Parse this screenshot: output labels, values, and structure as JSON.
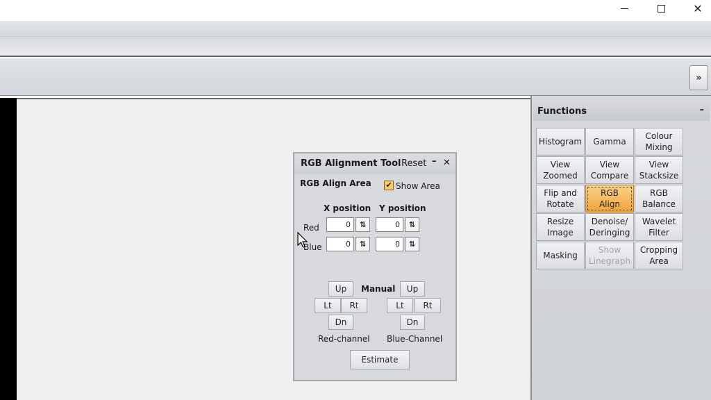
{
  "window": {
    "minimize_glyph": "—",
    "maximize_glyph": "☐",
    "close_glyph": "✕"
  },
  "toolbar": {
    "expand_label": "»"
  },
  "functions": {
    "title": "Functions",
    "collapse": "–",
    "buttons": [
      {
        "label": "Histogram",
        "state": "normal"
      },
      {
        "label": "Gamma",
        "state": "normal"
      },
      {
        "label": "Colour\nMixing",
        "state": "normal"
      },
      {
        "label": "View\nZoomed",
        "state": "normal"
      },
      {
        "label": "View\nCompare",
        "state": "normal"
      },
      {
        "label": "View\nStacksize",
        "state": "normal"
      },
      {
        "label": "Flip and\nRotate",
        "state": "normal"
      },
      {
        "label": "RGB\nAlign",
        "state": "active"
      },
      {
        "label": "RGB\nBalance",
        "state": "normal"
      },
      {
        "label": "Resize\nImage",
        "state": "normal"
      },
      {
        "label": "Denoise/\nDeringing",
        "state": "normal"
      },
      {
        "label": "Wavelet\nFilter",
        "state": "normal"
      },
      {
        "label": "Masking",
        "state": "normal"
      },
      {
        "label": "Show\nLinegraph",
        "state": "disabled"
      },
      {
        "label": "Cropping\nArea",
        "state": "normal"
      }
    ]
  },
  "rgb_tool": {
    "title": "RGB Alignment Tool",
    "reset": "Reset",
    "minimize": "–",
    "close": "✕",
    "area_label": "RGB Align Area",
    "show_area_label": "Show Area",
    "show_area_checked": true,
    "x_header": "X position",
    "y_header": "Y position",
    "red_label": "Red",
    "blue_label": "Blue",
    "red_x": "0",
    "red_y": "0",
    "blue_x": "0",
    "blue_y": "0",
    "spin_glyph": "⇅",
    "up": "Up",
    "dn": "Dn",
    "lt": "Lt",
    "rt": "Rt",
    "manual": "Manual",
    "red_channel": "Red-channel",
    "blue_channel": "Blue-Channel",
    "estimate": "Estimate"
  },
  "colors": {
    "active_button": "#f1a23b",
    "checkbox": "#f6c86a"
  }
}
